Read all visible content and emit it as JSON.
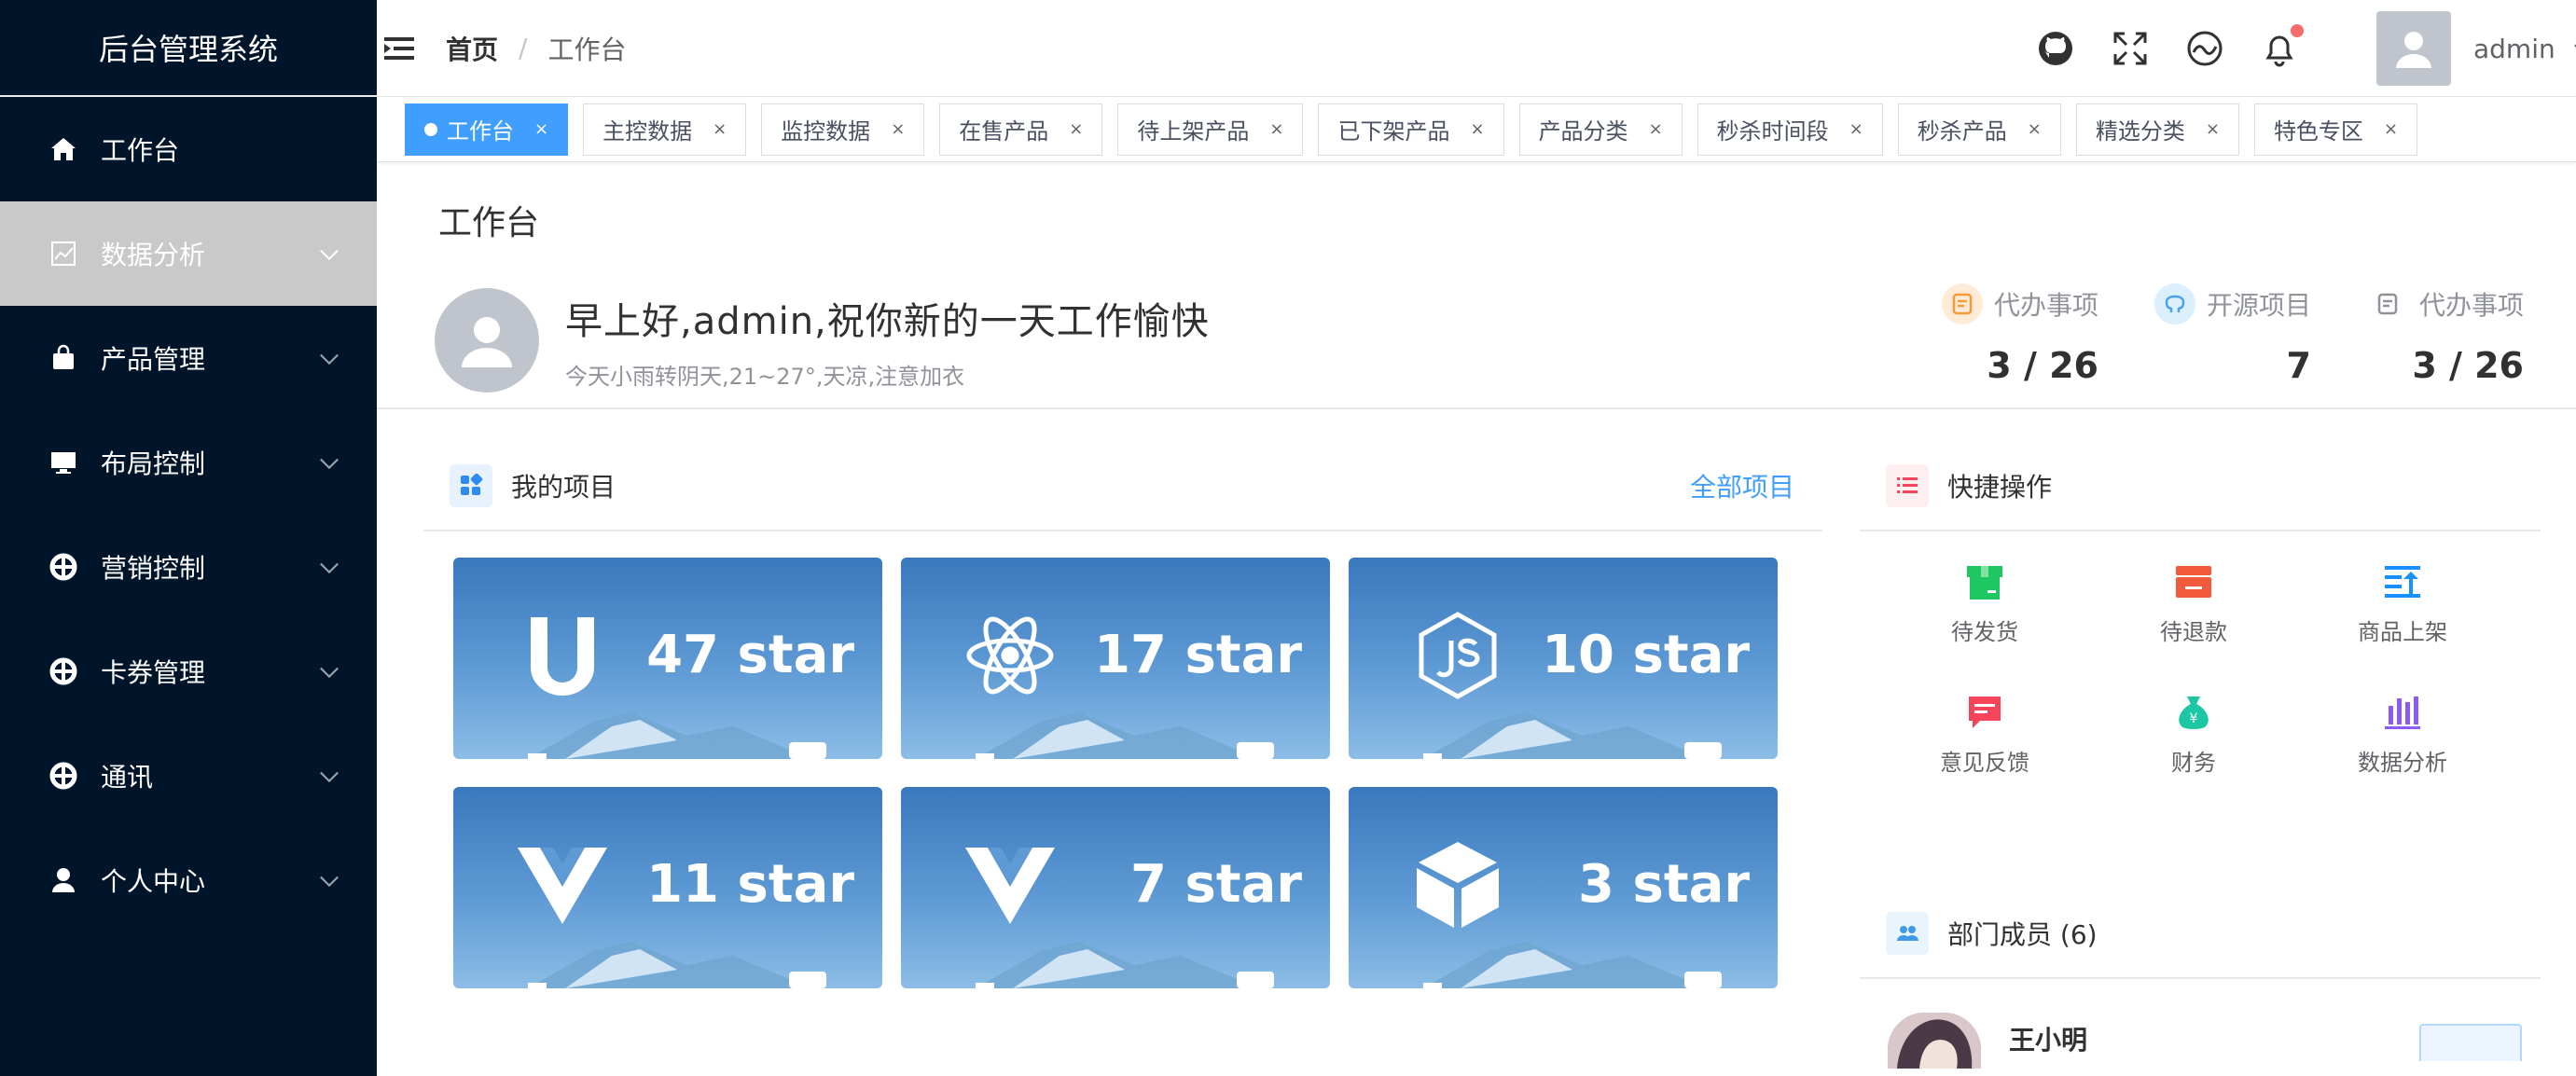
{
  "sidebar": {
    "title": "后台管理系统",
    "items": [
      {
        "label": "工作台",
        "icon": "home-icon"
      },
      {
        "label": "数据分析",
        "icon": "chart-icon"
      },
      {
        "label": "产品管理",
        "icon": "bag-icon"
      },
      {
        "label": "布局控制",
        "icon": "monitor-icon"
      },
      {
        "label": "营销控制",
        "icon": "lifebuoy-icon"
      },
      {
        "label": "卡券管理",
        "icon": "lifebuoy-icon"
      },
      {
        "label": "通讯",
        "icon": "lifebuoy-icon"
      },
      {
        "label": "个人中心",
        "icon": "user-icon"
      }
    ]
  },
  "header": {
    "breadcrumb": {
      "home": "首页",
      "separator": "/",
      "current": "工作台"
    },
    "username": "admin"
  },
  "tags": [
    {
      "label": "工作台",
      "active": true
    },
    {
      "label": "主控数据"
    },
    {
      "label": "监控数据"
    },
    {
      "label": "在售产品"
    },
    {
      "label": "待上架产品"
    },
    {
      "label": "已下架产品"
    },
    {
      "label": "产品分类"
    },
    {
      "label": "秒杀时间段"
    },
    {
      "label": "秒杀产品"
    },
    {
      "label": "精选分类"
    },
    {
      "label": "特色专区"
    }
  ],
  "tag_close": "×",
  "page": {
    "title": "工作台",
    "greeting": "早上好,admin,祝你新的一天工作愉快",
    "weather": "今天小雨转阴天,21~27°,天凉,注意加衣"
  },
  "stats": [
    {
      "label": "代办事项",
      "value": "3 / 26",
      "color": "#fdebd8",
      "icon": "todo-icon"
    },
    {
      "label": "开源项目",
      "value": "7",
      "color": "#dceffd",
      "icon": "github-icon"
    },
    {
      "label": "代办事项",
      "value": "3 / 26",
      "color": "#ffffff",
      "icon": "todo-icon"
    }
  ],
  "projects": {
    "title": "我的项目",
    "all_link": "全部项目",
    "items": [
      {
        "icon": "uview-icon",
        "stars": "47 star"
      },
      {
        "icon": "react-icon",
        "stars": "17 star"
      },
      {
        "icon": "nodejs-icon",
        "stars": "10 star"
      },
      {
        "icon": "vue-icon",
        "stars": "11 star"
      },
      {
        "icon": "vue-icon",
        "stars": "7 star"
      },
      {
        "icon": "cube-icon",
        "stars": "3 star"
      }
    ]
  },
  "quick": {
    "title": "快捷操作",
    "items": [
      {
        "label": "待发货",
        "icon": "box-icon",
        "color": "#1ec761"
      },
      {
        "label": "待退款",
        "icon": "refund-icon",
        "color": "#f15b3c"
      },
      {
        "label": "商品上架",
        "icon": "upload-icon",
        "color": "#1890ff"
      },
      {
        "label": "意见反馈",
        "icon": "feedback-icon",
        "color": "#f5455b"
      },
      {
        "label": "财务",
        "icon": "money-bag-icon",
        "color": "#1ec7a3"
      },
      {
        "label": "数据分析",
        "icon": "bar-chart-icon",
        "color": "#8a5cf5"
      }
    ]
  },
  "members": {
    "title": "部门成员 (6)",
    "first_name": "王小明"
  }
}
